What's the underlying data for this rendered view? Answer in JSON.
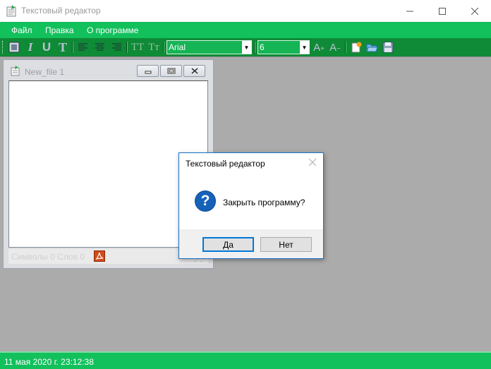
{
  "window": {
    "title": "Текстовый редактор",
    "controls": [
      "minimize-icon",
      "maximize-icon",
      "close-icon"
    ]
  },
  "menu": {
    "items": [
      "Файл",
      "Правка",
      "О программе"
    ]
  },
  "toolbar": {
    "buttons": [
      "format-icon",
      "italic-icon",
      "underline-icon",
      "text-t-icon",
      "align-left-icon",
      "align-center-icon",
      "align-right-icon",
      "uppercase-icon",
      "titlecase-icon",
      "font-increase-icon",
      "font-decrease-icon",
      "new-file-icon",
      "open-folder-icon",
      "save-icon"
    ],
    "font_name": "Arial",
    "font_size": "6"
  },
  "child_window": {
    "title": "New_file 1",
    "status_text": "Символы 0   Слов 0"
  },
  "dialog": {
    "title": "Текстовый редактор",
    "message": "Закрыть программу?",
    "yes_label": "Да",
    "no_label": "Нет",
    "icon": "question-icon"
  },
  "statusbar": {
    "datetime": "11 мая 2020 г. 23:12:38"
  },
  "colors": {
    "menu_green": "#12c05c",
    "toolbar_green": "#0f8a36",
    "workspace_gray": "#ababab",
    "dialog_accent": "#0078d7"
  }
}
